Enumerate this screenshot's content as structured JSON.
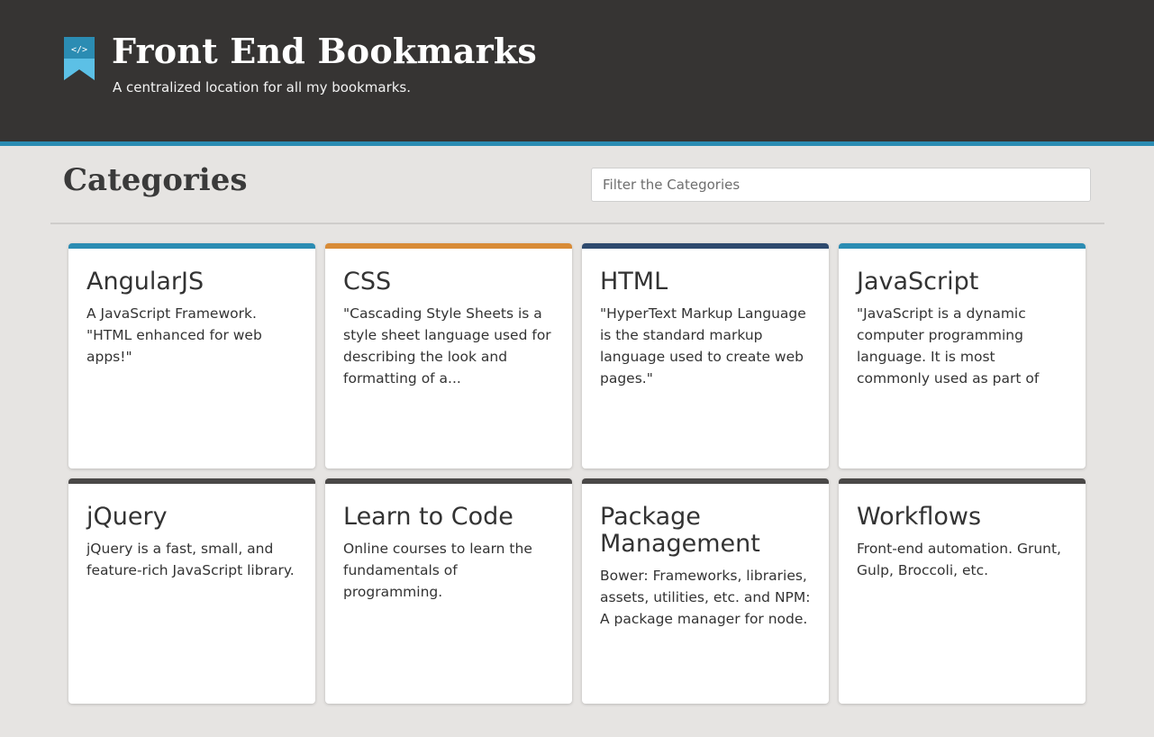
{
  "header": {
    "title": "Front End Bookmarks",
    "subtitle": "A centralized location for all my bookmarks.",
    "logo_icon": "bookmark-code-icon",
    "background_color": "#363433",
    "accent_color": "#2b8cb3"
  },
  "main": {
    "heading": "Categories",
    "filter": {
      "placeholder": "Filter the Categories",
      "value": ""
    }
  },
  "categories": [
    {
      "title": "AngularJS",
      "description": "A JavaScript Framework. \"HTML enhanced for web apps!\"",
      "color": "#2b8cb3"
    },
    {
      "title": "CSS",
      "description": "\"Cascading Style Sheets is a style sheet language used for describing the look and formatting of a...",
      "color": "#d88b37"
    },
    {
      "title": "HTML",
      "description": "\"HyperText Markup Language is the standard markup language used to create web pages.\"",
      "color": "#2e4a6e"
    },
    {
      "title": "JavaScript",
      "description": "\"JavaScript is a dynamic computer programming language. It is most commonly used as part of web...",
      "color": "#2b8cb3"
    },
    {
      "title": "jQuery",
      "description": "jQuery is a fast, small, and feature-rich JavaScript library.",
      "color": "#4a4847"
    },
    {
      "title": "Learn to Code",
      "description": "Online courses to learn the fundamentals of programming.",
      "color": "#4a4847"
    },
    {
      "title": "Package Management",
      "description": "Bower: Frameworks, libraries, assets, utilities, etc. and NPM: A package manager for node.",
      "color": "#4a4847"
    },
    {
      "title": "Workflows",
      "description": "Front-end automation. Grunt, Gulp, Broccoli, etc.",
      "color": "#4a4847"
    }
  ]
}
